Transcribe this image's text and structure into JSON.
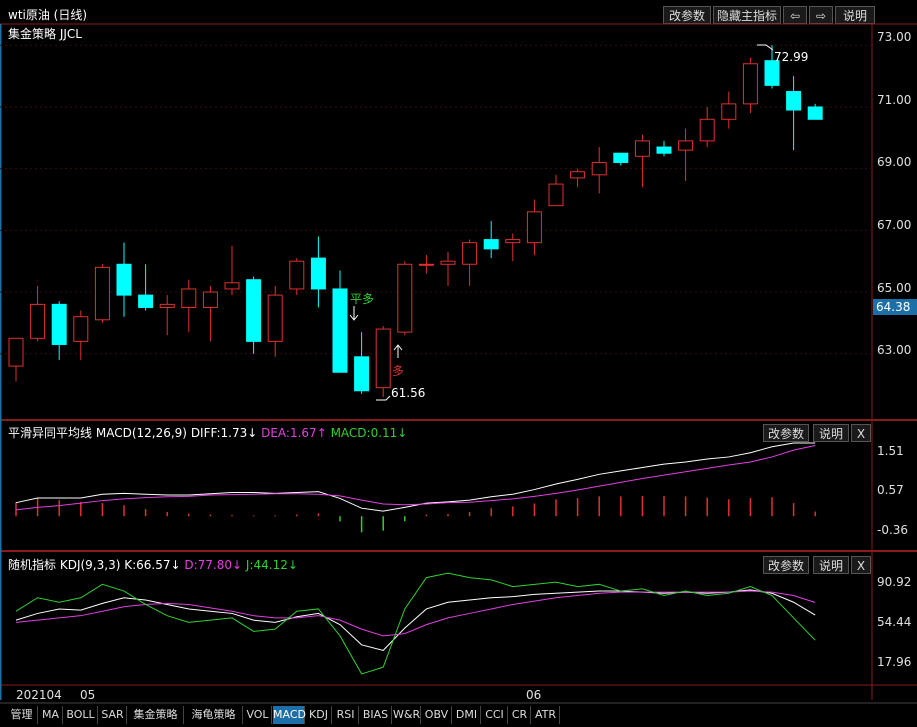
{
  "title": "wti原油 (日线)",
  "toolbar": {
    "params": "改参数",
    "hide_main": "隐藏主指标",
    "prev": "⇦",
    "next": "⇨",
    "help": "说明"
  },
  "main": {
    "strategy_label": "集金策略 JJCL",
    "y_ticks": [
      "73.00",
      "71.00",
      "69.00",
      "67.00",
      "65.00",
      "63.00"
    ],
    "current_price": "64.38",
    "high_label": "72.99",
    "low_label": "61.56",
    "signal_flat": "平多",
    "signal_long": "多",
    "colors": {
      "up": "#e03030",
      "down": "#00ffff",
      "flat_signal": "#30d030",
      "long_signal": "#e03030",
      "price_tag": "#1d6fa8"
    }
  },
  "macd": {
    "name": "平滑异同平均线",
    "params": "MACD(12,26,9)",
    "diff": "DIFF:1.73↓",
    "dea": "DEA:1.67↑",
    "macd": "MACD:0.11↓",
    "y_ticks": [
      "1.51",
      "0.57",
      "-0.36"
    ],
    "btn_params": "改参数",
    "btn_help": "说明",
    "btn_close": "X"
  },
  "kdj": {
    "name": "随机指标",
    "params": "KDJ(9,3,3)",
    "k": "K:66.57↓",
    "d": "D:77.80↓",
    "j": "J:44.12↓",
    "y_ticks": [
      "90.92",
      "54.44",
      "17.96"
    ],
    "btn_params": "改参数",
    "btn_help": "说明",
    "btn_close": "X"
  },
  "x_axis": [
    "202104",
    "05",
    "06"
  ],
  "tabs": [
    "管理",
    "MA",
    "BOLL",
    "SAR",
    "集金策略",
    "海龟策略",
    "VOL",
    "MACD",
    "KDJ",
    "RSI",
    "BIAS",
    "W&R",
    "OBV",
    "DMI",
    "CCI",
    "CR",
    "ATR"
  ],
  "chart_data": [
    {
      "type": "candlestick",
      "title": "wti原油 (日线)",
      "ylim": [
        61.5,
        73.3
      ],
      "candles": [
        {
          "o": 62.6,
          "h": 63.5,
          "l": 62.1,
          "c": 63.5
        },
        {
          "o": 63.5,
          "h": 65.2,
          "l": 63.4,
          "c": 64.6
        },
        {
          "o": 64.6,
          "h": 64.7,
          "l": 62.8,
          "c": 63.3
        },
        {
          "o": 63.4,
          "h": 64.4,
          "l": 62.8,
          "c": 64.2
        },
        {
          "o": 64.1,
          "h": 65.9,
          "l": 64.0,
          "c": 65.8
        },
        {
          "o": 65.9,
          "h": 66.6,
          "l": 64.2,
          "c": 64.9
        },
        {
          "o": 64.9,
          "h": 65.9,
          "l": 64.4,
          "c": 64.5
        },
        {
          "o": 64.5,
          "h": 64.9,
          "l": 63.6,
          "c": 64.6
        },
        {
          "o": 64.5,
          "h": 65.4,
          "l": 63.7,
          "c": 65.1
        },
        {
          "o": 64.5,
          "h": 65.2,
          "l": 63.4,
          "c": 65.0
        },
        {
          "o": 65.1,
          "h": 66.5,
          "l": 64.9,
          "c": 65.3
        },
        {
          "o": 65.4,
          "h": 65.5,
          "l": 63.0,
          "c": 63.4
        },
        {
          "o": 63.4,
          "h": 65.2,
          "l": 62.9,
          "c": 64.9
        },
        {
          "o": 65.1,
          "h": 66.1,
          "l": 64.9,
          "c": 66.0
        },
        {
          "o": 66.1,
          "h": 66.8,
          "l": 64.5,
          "c": 65.1
        },
        {
          "o": 65.1,
          "h": 65.7,
          "l": 62.6,
          "c": 62.4
        },
        {
          "o": 62.9,
          "h": 63.7,
          "l": 61.7,
          "c": 61.8
        },
        {
          "o": 61.9,
          "h": 63.9,
          "l": 61.6,
          "c": 63.8
        },
        {
          "o": 63.7,
          "h": 66.0,
          "l": 63.6,
          "c": 65.9
        },
        {
          "o": 65.9,
          "h": 66.2,
          "l": 65.6,
          "c": 65.9
        },
        {
          "o": 65.9,
          "h": 66.3,
          "l": 65.2,
          "c": 66.0
        },
        {
          "o": 65.9,
          "h": 66.7,
          "l": 65.2,
          "c": 66.6
        },
        {
          "o": 66.7,
          "h": 67.3,
          "l": 66.1,
          "c": 66.4
        },
        {
          "o": 66.6,
          "h": 66.9,
          "l": 66.0,
          "c": 66.7
        },
        {
          "o": 66.6,
          "h": 68.0,
          "l": 66.2,
          "c": 67.6
        },
        {
          "o": 67.8,
          "h": 68.8,
          "l": 67.8,
          "c": 68.5
        },
        {
          "o": 68.7,
          "h": 69.0,
          "l": 68.4,
          "c": 68.9
        },
        {
          "o": 68.8,
          "h": 69.7,
          "l": 68.2,
          "c": 69.2
        },
        {
          "o": 69.5,
          "h": 69.5,
          "l": 69.1,
          "c": 69.2
        },
        {
          "o": 69.4,
          "h": 70.1,
          "l": 68.4,
          "c": 69.9
        },
        {
          "o": 69.7,
          "h": 69.9,
          "l": 69.4,
          "c": 69.5
        },
        {
          "o": 69.6,
          "h": 70.3,
          "l": 68.6,
          "c": 69.9
        },
        {
          "o": 69.9,
          "h": 71.0,
          "l": 69.7,
          "c": 70.6
        },
        {
          "o": 70.6,
          "h": 71.5,
          "l": 70.3,
          "c": 71.1
        },
        {
          "o": 71.1,
          "h": 72.6,
          "l": 70.8,
          "c": 72.4
        },
        {
          "o": 72.5,
          "h": 73.0,
          "l": 71.6,
          "c": 71.7
        },
        {
          "o": 71.5,
          "h": 72.0,
          "l": 69.6,
          "c": 70.9
        },
        {
          "o": 71.0,
          "h": 71.1,
          "l": 70.6,
          "c": 70.6
        }
      ]
    },
    {
      "type": "line",
      "title": "MACD(12,26,9)",
      "ylim": [
        -0.75,
        1.8
      ],
      "series": [
        {
          "name": "DIFF",
          "values": [
            0.32,
            0.43,
            0.43,
            0.43,
            0.52,
            0.54,
            0.52,
            0.5,
            0.5,
            0.53,
            0.56,
            0.56,
            0.54,
            0.56,
            0.58,
            0.42,
            0.19,
            0.12,
            0.21,
            0.31,
            0.34,
            0.38,
            0.46,
            0.52,
            0.63,
            0.76,
            0.87,
            0.99,
            1.07,
            1.15,
            1.23,
            1.28,
            1.35,
            1.4,
            1.5,
            1.64,
            1.73,
            1.73
          ]
        },
        {
          "name": "DEA",
          "values": [
            0.15,
            0.21,
            0.25,
            0.31,
            0.37,
            0.41,
            0.44,
            0.46,
            0.47,
            0.5,
            0.51,
            0.52,
            0.53,
            0.53,
            0.52,
            0.48,
            0.38,
            0.29,
            0.27,
            0.29,
            0.32,
            0.33,
            0.37,
            0.41,
            0.47,
            0.54,
            0.62,
            0.71,
            0.8,
            0.89,
            0.97,
            1.05,
            1.13,
            1.21,
            1.28,
            1.4,
            1.56,
            1.67
          ]
        },
        {
          "name": "MACD",
          "values": [
            0.33,
            0.44,
            0.38,
            0.34,
            0.31,
            0.26,
            0.17,
            0.1,
            0.06,
            0.04,
            0.03,
            0.02,
            0.02,
            0.04,
            0.07,
            -0.12,
            -0.38,
            -0.34,
            -0.12,
            0.04,
            0.05,
            0.1,
            0.19,
            0.23,
            0.3,
            0.4,
            0.43,
            0.47,
            0.47,
            0.48,
            0.48,
            0.47,
            0.44,
            0.4,
            0.43,
            0.45,
            0.31,
            0.11
          ]
        }
      ]
    },
    {
      "type": "line",
      "title": "KDJ(9,3,3)",
      "ylim": [
        5,
        105
      ],
      "series": [
        {
          "name": "K",
          "values": [
            62,
            68,
            72,
            71,
            77,
            82,
            80,
            76,
            72,
            70,
            68,
            62,
            60,
            65,
            68,
            58,
            40,
            35,
            55,
            72,
            78,
            80,
            82,
            83,
            85,
            86,
            87,
            88,
            88,
            87,
            86,
            87,
            86,
            87,
            89,
            86,
            78,
            66.57
          ]
        },
        {
          "name": "D",
          "values": [
            60,
            62,
            64,
            66,
            70,
            74,
            76,
            77,
            76,
            73,
            70,
            66,
            64,
            64,
            66,
            62,
            54,
            48,
            50,
            58,
            64,
            68,
            72,
            76,
            79,
            82,
            84,
            86,
            87,
            87,
            87,
            87,
            87,
            87,
            88,
            87,
            84,
            77.8
          ]
        },
        {
          "name": "J",
          "values": [
            70,
            82,
            78,
            82,
            94,
            88,
            76,
            66,
            60,
            62,
            64,
            52,
            54,
            70,
            72,
            48,
            14,
            20,
            72,
            100,
            104,
            100,
            98,
            92,
            94,
            96,
            92,
            94,
            88,
            90,
            84,
            88,
            84,
            86,
            92,
            84,
            64,
            44.12
          ]
        }
      ]
    }
  ]
}
